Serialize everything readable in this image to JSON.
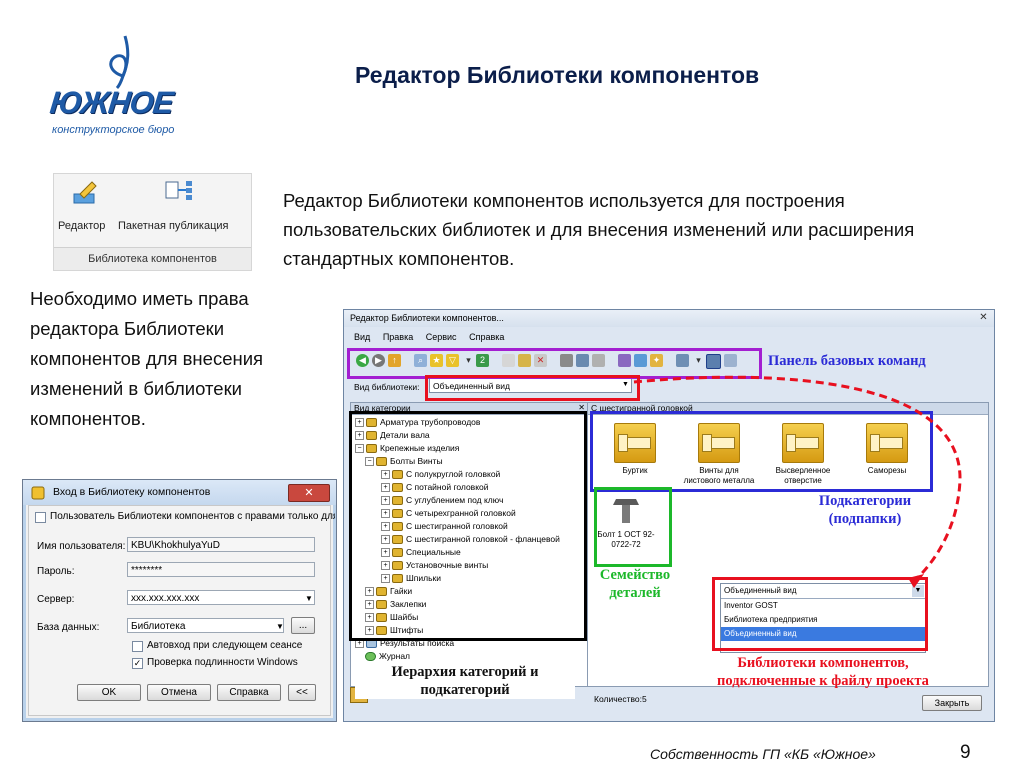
{
  "colors": {
    "title": "#0b1e4a",
    "logo": "#1e5aa6",
    "annotation_red": "#e8101f",
    "annotation_blue": "#2b2bd6",
    "annotation_green": "#1cb82a",
    "annotation_purple": "#a31fd1"
  },
  "logo": {
    "word": "ЮЖНОЕ",
    "sub": "конструкторское бюро",
    "icon": "fountain-pen-icon"
  },
  "slide": {
    "title": "Редактор Библиотеки компонентов",
    "intro": "Редактор Библиотеки компонентов используется для построения пользовательских библиотек и для внесения изменений или расширения стандартных компонентов.",
    "note": "Необходимо иметь права редактора Библиотеки компонентов для внесения изменений в библиотеки компонентов.",
    "footer": "Собственность ГП «КБ «Южное»",
    "page": "9"
  },
  "ribbon": {
    "editor": "Редактор",
    "batch": "Пакетная публикация",
    "group": "Библиотека компонентов"
  },
  "login": {
    "title": "Вход в Библиотеку компонентов",
    "user_checkbox": "Пользователь Библиотеки компонентов с правами только для ч",
    "user_label": "Имя пользователя:",
    "user_value": "KBU\\KhokhulyaYuD",
    "password_label": "Пароль:",
    "password_value": "********",
    "server_label": "Сервер:",
    "server_value": "xxx.xxx.xxx.xxx",
    "db_label": "База данных:",
    "db_value": "Библиотека",
    "db_more": "...",
    "autologin": "Автовход при следующем сеансе",
    "windows_auth": "Проверка подлинности Windows",
    "ok": "OK",
    "cancel": "Отмена",
    "help": "Справка",
    "collapse": "<<"
  },
  "editor": {
    "title": "Редактор Библиотеки компонентов...",
    "menu": [
      "Вид",
      "Правка",
      "Сервис",
      "Справка"
    ],
    "library_label": "Вид библиотеки:",
    "library_value": "Объединенный вид",
    "categories_header": "Вид категории",
    "content_header": "С шестигранной головкой",
    "tree": [
      "Арматура трубопроводов",
      "Детали вала",
      "Крепежные изделия",
      "Болты Винты",
      "С полукруглой головкой",
      "С потайной головкой",
      "С углублением под ключ",
      "С четырехгранной головкой",
      "С шестигранной головкой",
      "С шестигранной головкой - фланцевой",
      "Специальные",
      "Установочные винты",
      "Шпильки",
      "Гайки",
      "Заклепки",
      "Шайбы",
      "Штифты",
      "Результаты поиска",
      "Журнал"
    ],
    "subcategories": [
      "Буртик",
      "Винты для листового металла",
      "Высверленное отверстие",
      "Саморезы"
    ],
    "family": "Болт 1 ОСТ 92-0722-72",
    "dropdown_value": "Объединенный вид",
    "dropdown_options": [
      "Inventor GOST",
      "Библиотека предприятия",
      "Объединенный вид"
    ],
    "count": "Количество:5",
    "close": "Закрыть"
  },
  "annotations": {
    "toolbar": "Панель базовых команд",
    "subcategories": "Подкатегории (подпапки)",
    "family": "Семейство деталей",
    "hierarchy": "Иерархия категорий и подкатегорий",
    "libraries": "Библиотеки компонентов, подключенные к файлу проекта"
  }
}
